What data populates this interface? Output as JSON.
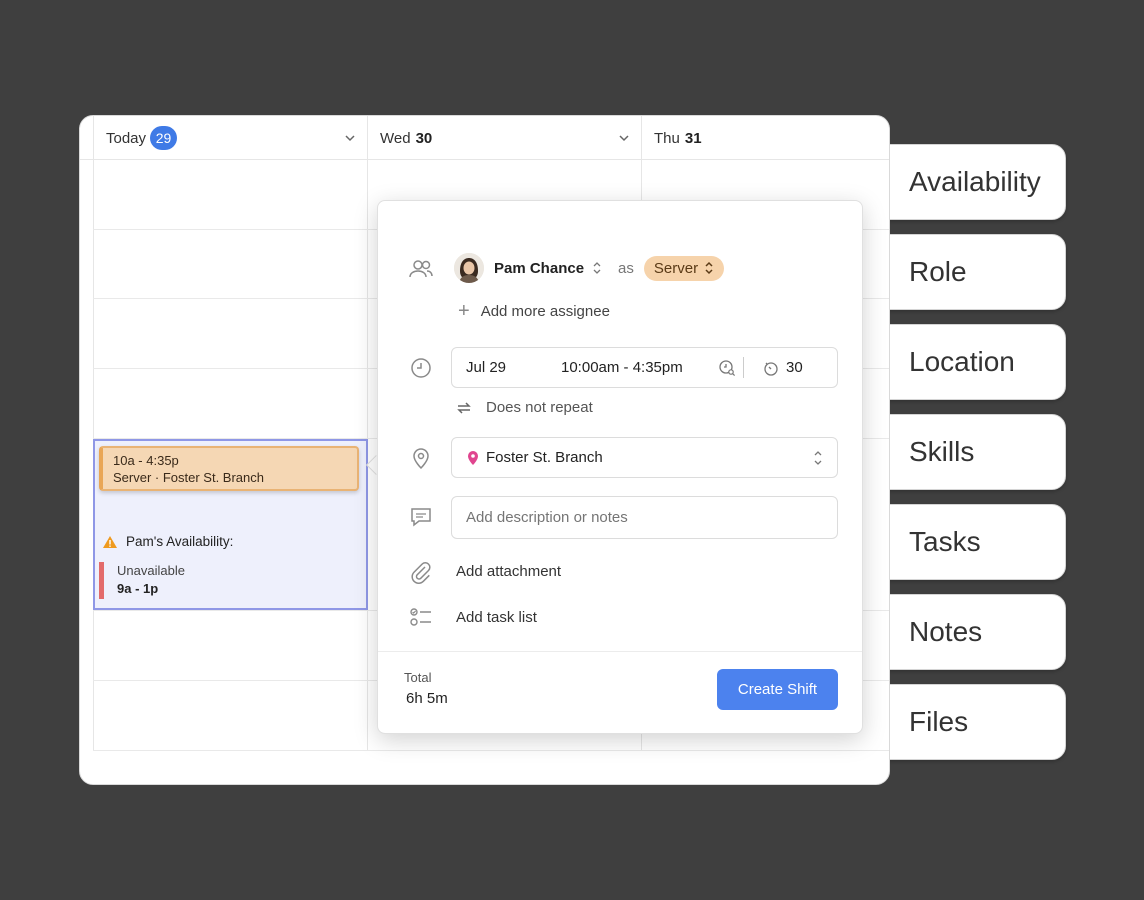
{
  "calendar": {
    "days": [
      {
        "label": "Today",
        "num": "29"
      },
      {
        "label": "Wed",
        "num": "30"
      },
      {
        "label": "Thu",
        "num": "31"
      }
    ],
    "event": {
      "time": "10a - 4:35p",
      "detail": "Server · Foster St. Branch"
    },
    "availability": {
      "title": "Pam's Availability:",
      "status": "Unavailable",
      "range": "9a - 1p"
    }
  },
  "popover": {
    "assignee_name": "Pam Chance",
    "as_text": "as",
    "role": "Server",
    "add_assignee": "Add more assignee",
    "date": "Jul 29",
    "time_range": "10:00am -  4:35pm",
    "break_minutes": "30",
    "repeat": "Does not repeat",
    "location": "Foster St. Branch",
    "description_placeholder": "Add description or notes",
    "attachment": "Add attachment",
    "task_list": "Add task list",
    "total_label": "Total",
    "total_value": "6h 5m",
    "create_button": "Create Shift"
  },
  "side_tabs": [
    "Availability",
    "Role",
    "Location",
    "Skills",
    "Tasks",
    "Notes",
    "Files"
  ],
  "colors": {
    "accent": "#4c82ee",
    "today_badge": "#3f7ae6",
    "event_fill": "#f5d7b4",
    "role_pill": "#f6d3ab",
    "unavailable": "#e36b6b",
    "selection": "#eef0fc"
  }
}
